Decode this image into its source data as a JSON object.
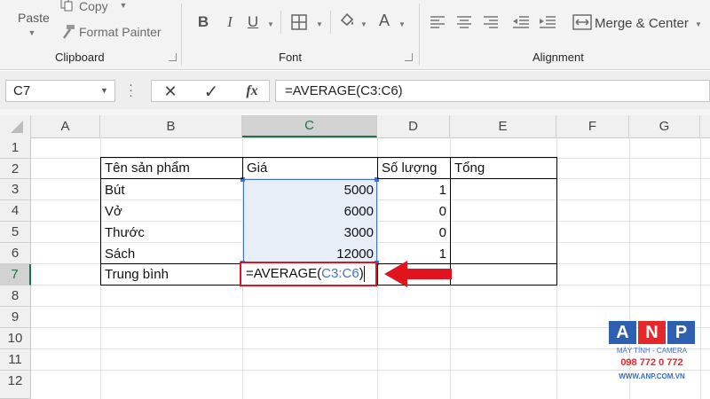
{
  "ribbon": {
    "clipboard": {
      "paste": "Paste",
      "copy": "Copy",
      "format_painter": "Format Painter",
      "label": "Clipboard"
    },
    "font": {
      "label": "Font",
      "bold": "B",
      "italic": "I",
      "underline": "U",
      "font_color": "A"
    },
    "alignment": {
      "label": "Alignment",
      "merge_center": "Merge & Center"
    }
  },
  "formula_bar": {
    "name_box": "C7",
    "cancel_icon": "✕",
    "enter_icon": "✓",
    "fx_label": "fx",
    "formula": "=AVERAGE(C3:C6)"
  },
  "columns": [
    "A",
    "B",
    "C",
    "D",
    "E",
    "F",
    "G"
  ],
  "rows": [
    "1",
    "2",
    "3",
    "4",
    "5",
    "6",
    "7",
    "8",
    "9",
    "10",
    "11",
    "12"
  ],
  "table": {
    "headers": [
      "Tên sản phẩm",
      "Giá",
      "Số lượng",
      "Tổng"
    ],
    "products": [
      {
        "name": "Bút",
        "price": "5000",
        "qty": "1"
      },
      {
        "name": "Vở",
        "price": "6000",
        "qty": "0"
      },
      {
        "name": "Thước",
        "price": "3000",
        "qty": "0"
      },
      {
        "name": "Sách",
        "price": "12000",
        "qty": "1"
      }
    ],
    "average_label": "Trung bình",
    "edit": {
      "func": "=AVERAGE(",
      "range": "C3:C6",
      "close": ")"
    }
  },
  "watermark": {
    "letters": [
      "A",
      "N",
      "P"
    ],
    "line1": "MÁY TÍNH - CAMERA",
    "line2": "098 772 0 772",
    "line3": "WWW.ANP.COM.VN"
  },
  "colors": {
    "selection_fill": "#e8eef8",
    "selection_border": "#4472c4",
    "range_text": "#4472c4",
    "highlight_red": "#e0141e",
    "active_col_header": "#d2d2d2",
    "active_row_header": "#d2d2d2"
  }
}
